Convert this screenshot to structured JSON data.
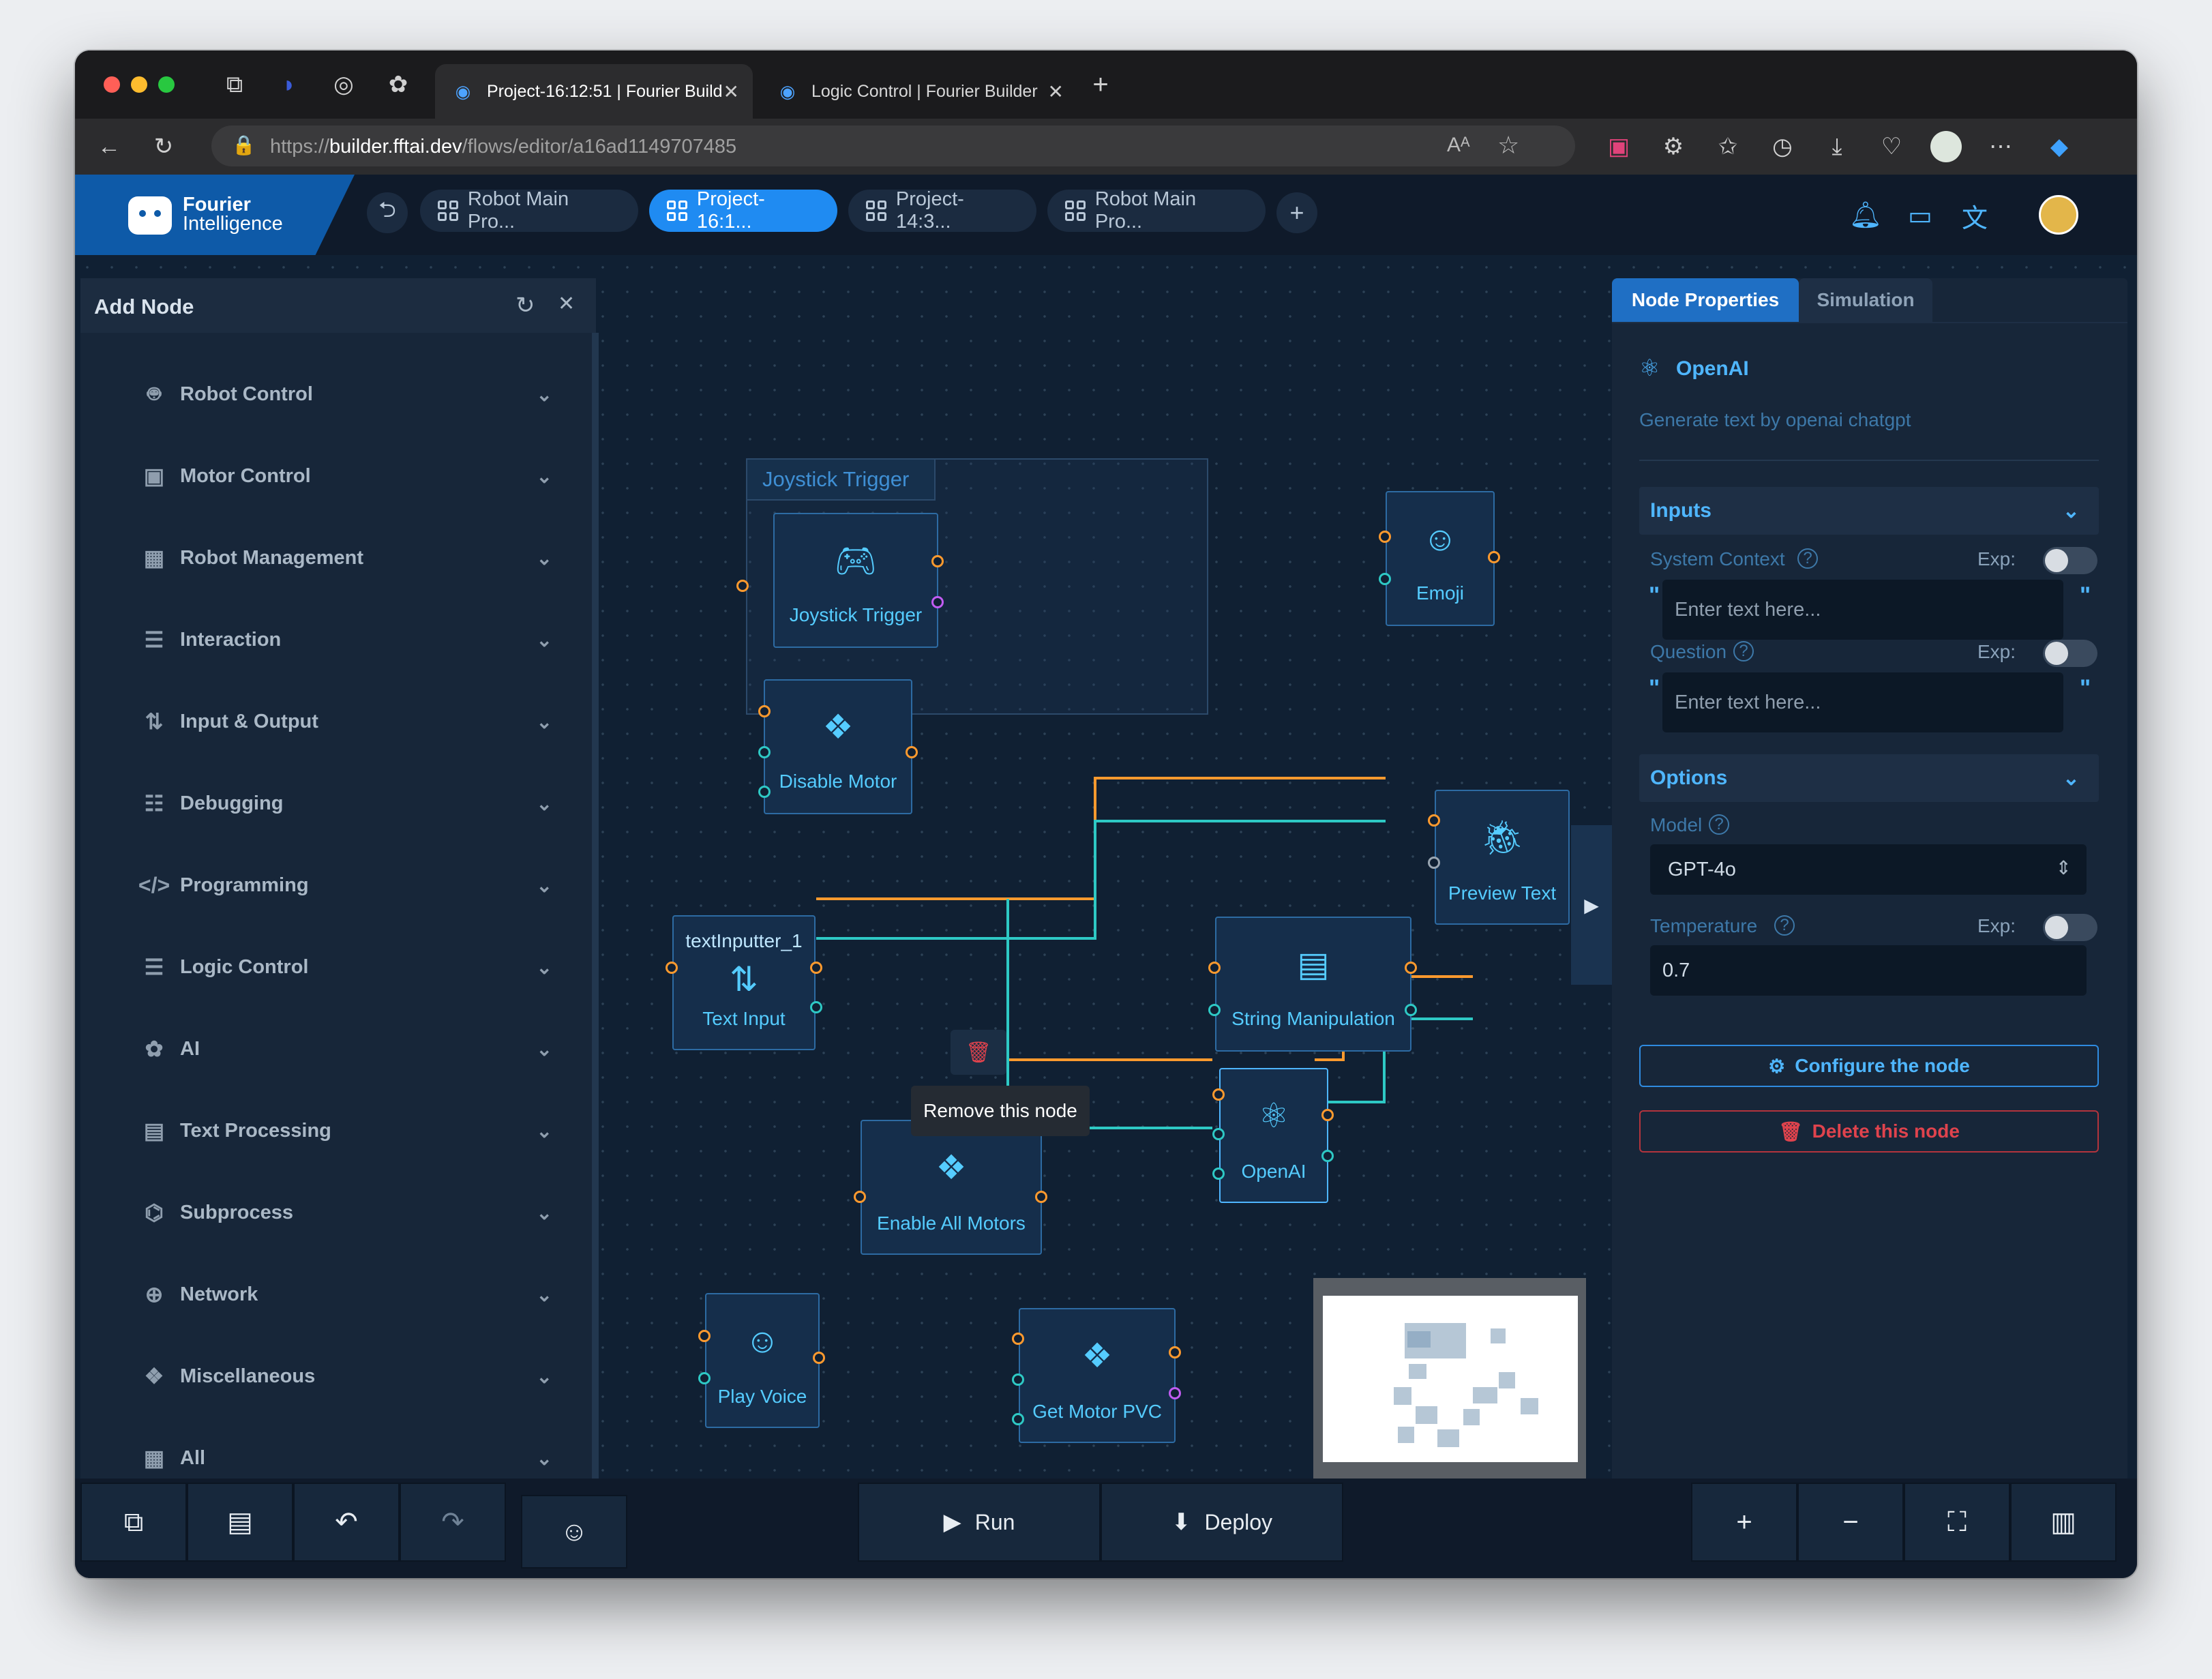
{
  "browser": {
    "tabs": [
      {
        "label": "Project-16:12:51 | Fourier Build",
        "active": true
      },
      {
        "label": "Logic Control | Fourier Builder",
        "active": false
      }
    ],
    "new_tab_symbol": "+",
    "url_scheme": "https://",
    "url_host": "builder.fftai.dev",
    "url_path": "/flows/editor/a16ad1149707485"
  },
  "app": {
    "logo_line1": "Fourier",
    "logo_line2": "Intelligence",
    "project_tabs": [
      {
        "label": "Robot Main Pro...",
        "active": false
      },
      {
        "label": "Project-16:1...",
        "active": true
      },
      {
        "label": "Project-14:3...",
        "active": false
      },
      {
        "label": "Robot Main Pro...",
        "active": false
      }
    ],
    "add_tab_symbol": "+"
  },
  "left_panel": {
    "title": "Add Node",
    "categories": [
      {
        "label": "Robot Control",
        "icon": "robot-icon"
      },
      {
        "label": "Motor Control",
        "icon": "motor-icon"
      },
      {
        "label": "Robot Management",
        "icon": "grid-icon"
      },
      {
        "label": "Interaction",
        "icon": "list-icon"
      },
      {
        "label": "Input & Output",
        "icon": "arrows-icon"
      },
      {
        "label": "Debugging",
        "icon": "sliders-icon"
      },
      {
        "label": "Programming",
        "icon": "code-icon"
      },
      {
        "label": "Logic Control",
        "icon": "list-icon"
      },
      {
        "label": "AI",
        "icon": "openai-icon"
      },
      {
        "label": "Text Processing",
        "icon": "document-icon"
      },
      {
        "label": "Subprocess",
        "icon": "hierarchy-icon"
      },
      {
        "label": "Network",
        "icon": "globe-icon"
      },
      {
        "label": "Miscellaneous",
        "icon": "diamonds-icon"
      },
      {
        "label": "All",
        "icon": "all-grid-icon"
      }
    ]
  },
  "canvas": {
    "group_title": "Joystick Trigger",
    "nodes": {
      "joystick_trigger": "Joystick Trigger",
      "disable_motor": "Disable Motor",
      "emoji": "Emoji",
      "preview_text": "Preview Text",
      "text_input_title": "textInputter_1",
      "text_input": "Text Input",
      "string_manipulation": "String Manipulation",
      "enable_all_motors": "Enable All Motors",
      "openai": "OpenAI",
      "play_voice": "Play Voice",
      "get_motor_pvc": "Get Motor PVC"
    },
    "tooltip": "Remove this node"
  },
  "right_panel": {
    "tabs": [
      {
        "label": "Node Properties",
        "active": true
      },
      {
        "label": "Simulation",
        "active": false
      }
    ],
    "node_title": "OpenAI",
    "node_description": "Generate text by openai chatgpt",
    "inputs_section": "Inputs",
    "system_context_label": "System Context",
    "question_label": "Question",
    "exp_label": "Exp:",
    "text_placeholder": "Enter text here...",
    "quote_char": "\"",
    "options_section": "Options",
    "model_label": "Model",
    "model_value": "GPT-4o",
    "temperature_label": "Temperature",
    "temperature_value": "0.7",
    "configure_button": "Configure the node",
    "delete_button": "Delete this node"
  },
  "bottom_bar": {
    "run": "Run",
    "deploy": "Deploy"
  },
  "colors": {
    "accent": "#1f8bf2",
    "node_text": "#55ccff",
    "port_orange": "#ff9a2e",
    "port_cyan": "#2ec9c5",
    "port_purple": "#c15cf2",
    "danger": "#e0434d"
  }
}
